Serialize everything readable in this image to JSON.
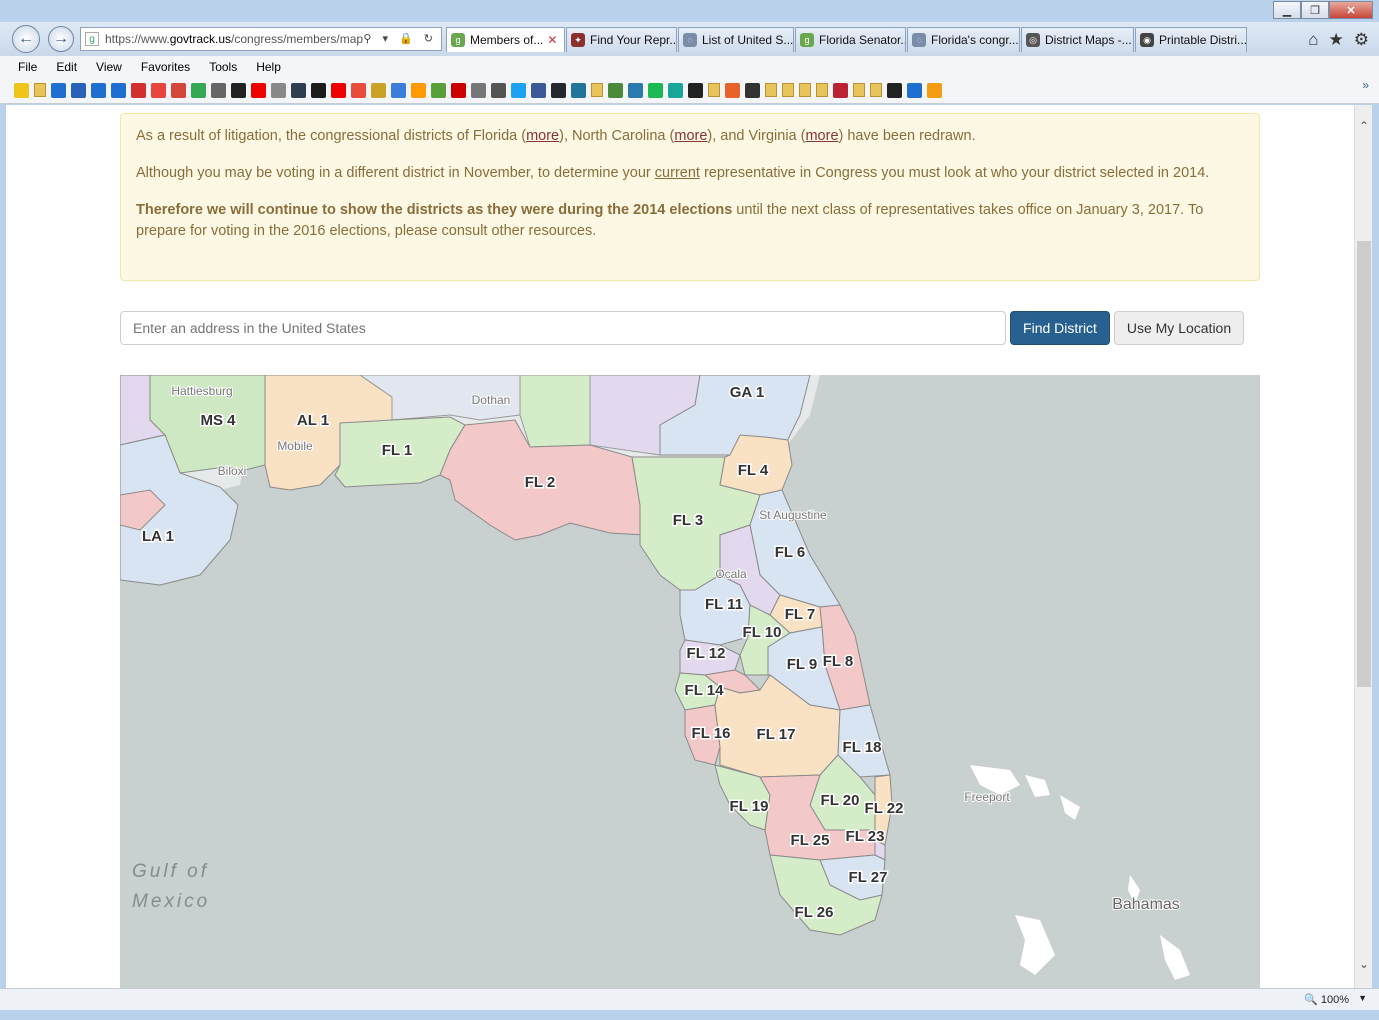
{
  "window": {
    "minimize": "▁",
    "maximize": "❐",
    "close": "✕"
  },
  "nav": {
    "back": "←",
    "forward": "→",
    "url_prefix": "https://www.",
    "url_host": "govtrack.us",
    "url_path": "/congress/members/map",
    "addr_icons": "⚲ ▾ 🔒 ↻"
  },
  "tabs": [
    {
      "label": "Members of...",
      "active": true,
      "fav": "g",
      "color": "#6aa84f"
    },
    {
      "label": "Find Your Repr...",
      "active": false,
      "fav": "✦",
      "color": "#8b2f2f"
    },
    {
      "label": "List of United S...",
      "active": false,
      "fav": "◌",
      "color": "#7b8ca8"
    },
    {
      "label": "Florida Senator...",
      "active": false,
      "fav": "g",
      "color": "#6aa84f"
    },
    {
      "label": "Florida's congr...",
      "active": false,
      "fav": "◌",
      "color": "#7b8ca8"
    },
    {
      "label": "District Maps -...",
      "active": false,
      "fav": "◎",
      "color": "#555555"
    },
    {
      "label": "Printable Distri...",
      "active": false,
      "fav": "◉",
      "color": "#444444"
    }
  ],
  "right_icons": {
    "home": "⌂",
    "favorites": "★",
    "settings": "⚙"
  },
  "menu": [
    "File",
    "Edit",
    "View",
    "Favorites",
    "Tools",
    "Help"
  ],
  "favorites_bar": {
    "chevron": "»"
  },
  "alert": {
    "p1_a": "As a result of litigation, the congressional districts of Florida (",
    "more1": "more",
    "p1_b": "), North Carolina (",
    "more2": "more",
    "p1_c": "), and Virginia (",
    "more3": "more",
    "p1_d": ") have been redrawn.",
    "p2_a": "Although you may be voting in a different district in November, to determine your ",
    "current": "current",
    "p2_b": " representative in Congress you must look at who your district selected in 2014.",
    "p3_bold": "Therefore we will continue to show the districts as they were during the 2014 elections",
    "p3_rest": " until the next class of representatives takes office on January 3, 2017. To prepare for voting in the 2016 elections, please consult other resources."
  },
  "search": {
    "placeholder": "Enter an address in the United States",
    "find_label": "Find District",
    "location_label": "Use My Location"
  },
  "map": {
    "districts": [
      {
        "id": "MS 4",
        "color": "#cfe8c4"
      },
      {
        "id": "AL 1",
        "color": "#f9e1c4"
      },
      {
        "id": "FL 1",
        "color": "#d5ecc9"
      },
      {
        "id": "FL 2",
        "color": "#f3c8c8"
      },
      {
        "id": "GA 1",
        "color": "#d9e4f2"
      },
      {
        "id": "FL 4",
        "color": "#f9e1c4"
      },
      {
        "id": "FL 3",
        "color": "#d5ecc9"
      },
      {
        "id": "LA 1",
        "color": "#d9e4f2"
      },
      {
        "id": "FL 6",
        "color": "#d9e4f2"
      },
      {
        "id": "FL 11",
        "color": "#d9e4f2"
      },
      {
        "id": "FL 7",
        "color": "#f9e1c4"
      },
      {
        "id": "FL 10",
        "color": "#d5ecc9"
      },
      {
        "id": "FL 8",
        "color": "#f3c8c8"
      },
      {
        "id": "FL 12",
        "color": "#e3d9ef"
      },
      {
        "id": "FL 9",
        "color": "#d9e4f2"
      },
      {
        "id": "FL 14",
        "color": "#d5ecc9"
      },
      {
        "id": "FL 16",
        "color": "#f3c8c8"
      },
      {
        "id": "FL 17",
        "color": "#f9e1c4"
      },
      {
        "id": "FL 18",
        "color": "#d9e4f2"
      },
      {
        "id": "FL 19",
        "color": "#d5ecc9"
      },
      {
        "id": "FL 20",
        "color": "#d5ecc9"
      },
      {
        "id": "FL 22",
        "color": "#f9e1c4"
      },
      {
        "id": "FL 25",
        "color": "#f3c8c8"
      },
      {
        "id": "FL 23",
        "color": "#e3d9ef"
      },
      {
        "id": "FL 27",
        "color": "#d9e4f2"
      },
      {
        "id": "FL 26",
        "color": "#d5ecc9"
      }
    ],
    "places": [
      "Hattiesburg",
      "Dothan",
      "Mobile",
      "Biloxi",
      "St Augustine",
      "Ocala",
      "Freeport"
    ],
    "water": [
      "Gulf of",
      "Mexico"
    ],
    "country": "Bahamas"
  },
  "statusbar": {
    "zoom": "100%",
    "zoom_icon": "🔍"
  }
}
